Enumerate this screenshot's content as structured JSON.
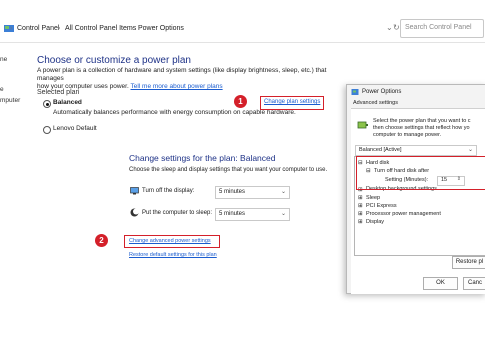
{
  "breadcrumb": [
    "Control Panel",
    "All Control Panel Items",
    "Power Options"
  ],
  "search_placeholder": "Search Control Panel",
  "left_edge": [
    "ne",
    "e",
    "mputer"
  ],
  "main": {
    "title": "Choose or customize a power plan",
    "intro_line1": "A power plan is a collection of hardware and system settings (like display brightness, sleep, etc.) that manages",
    "intro_line2": "how your computer uses power.",
    "intro_link": "Tell me more about power plans",
    "selected_plan_label": "Selected plan",
    "plan_balanced": "Balanced",
    "plan_balanced_desc": "Automatically balances performance with energy consumption on capable hardware.",
    "plan_lenovo": "Lenovo Default",
    "change_plan_link": "Change plan settings"
  },
  "plan_settings": {
    "title": "Change settings for the plan: Balanced",
    "subtitle": "Choose the sleep and display settings that you want your computer to use.",
    "display_label": "Turn off the display:",
    "display_value": "5 minutes",
    "sleep_label": "Put the computer to sleep:",
    "sleep_value": "5 minutes",
    "advanced_link": "Change advanced power settings",
    "restore_link": "Restore default settings for this plan"
  },
  "badges": [
    "1",
    "2"
  ],
  "dialog": {
    "title": "Power Options",
    "tab": "Advanced settings",
    "desc_line1": "Select the power plan that you want to c",
    "desc_line2": "then choose settings that reflect how yo",
    "desc_line3": "computer to manage power.",
    "plan_select": "Balanced [Active]",
    "tree": {
      "hard_disk": "Hard disk",
      "turn_off_after": "Turn off hard disk after",
      "setting_label": "Setting (Minutes):",
      "setting_value": "15",
      "desktop_bg": "Desktop background settings",
      "sleep": "Sleep",
      "pci": "PCI Express",
      "processor": "Processor power management",
      "display": "Display"
    },
    "restore_button": "Restore pl",
    "ok": "OK",
    "cancel": "Canc"
  },
  "colors": {
    "accent_blue": "#1e3287",
    "link_blue": "#1a5ccf",
    "highlight_red": "#d4202a"
  }
}
